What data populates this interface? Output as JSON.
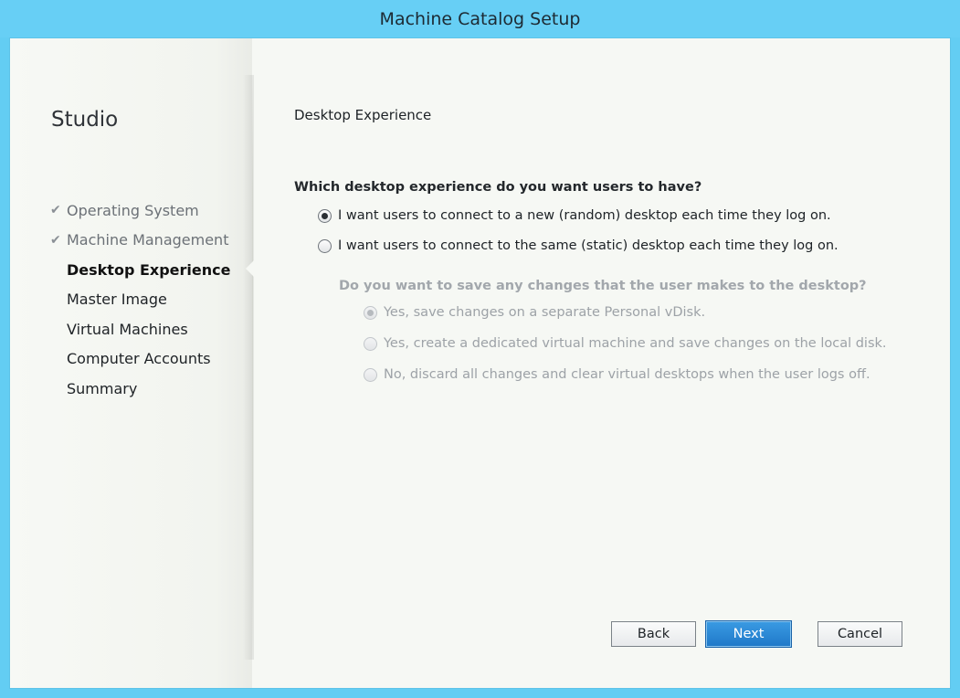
{
  "window": {
    "title": "Machine Catalog Setup"
  },
  "sidebar": {
    "app_title": "Studio",
    "check_glyph": "✔",
    "steps": [
      {
        "label": "Operating System",
        "state": "done"
      },
      {
        "label": "Machine Management",
        "state": "done"
      },
      {
        "label": "Desktop Experience",
        "state": "current"
      },
      {
        "label": "Master Image",
        "state": "pending"
      },
      {
        "label": "Virtual Machines",
        "state": "pending"
      },
      {
        "label": "Computer Accounts",
        "state": "pending"
      },
      {
        "label": "Summary",
        "state": "pending"
      }
    ]
  },
  "main": {
    "page_title": "Desktop Experience",
    "question": "Which desktop experience do you want users to have?",
    "options": [
      {
        "label": "I want users to connect to a new (random) desktop each time they log on.",
        "selected": true
      },
      {
        "label": "I want users to connect to the same (static) desktop each time they log on.",
        "selected": false
      }
    ],
    "sub_question": "Do you want to save any changes that the user makes to the desktop?",
    "sub_options": [
      {
        "label": "Yes, save changes on a separate Personal vDisk.",
        "selected": true,
        "disabled": true
      },
      {
        "label": "Yes, create a dedicated virtual machine and save changes on the local disk.",
        "selected": false,
        "disabled": true
      },
      {
        "label": "No, discard all changes and clear virtual desktops when the user logs off.",
        "selected": false,
        "disabled": true
      }
    ]
  },
  "footer": {
    "back_label": "Back",
    "next_label": "Next",
    "cancel_label": "Cancel"
  },
  "colors": {
    "titlebar": "#67cff5",
    "primary_button": "#2a86d3",
    "panel_background": "#f6f8f4"
  }
}
